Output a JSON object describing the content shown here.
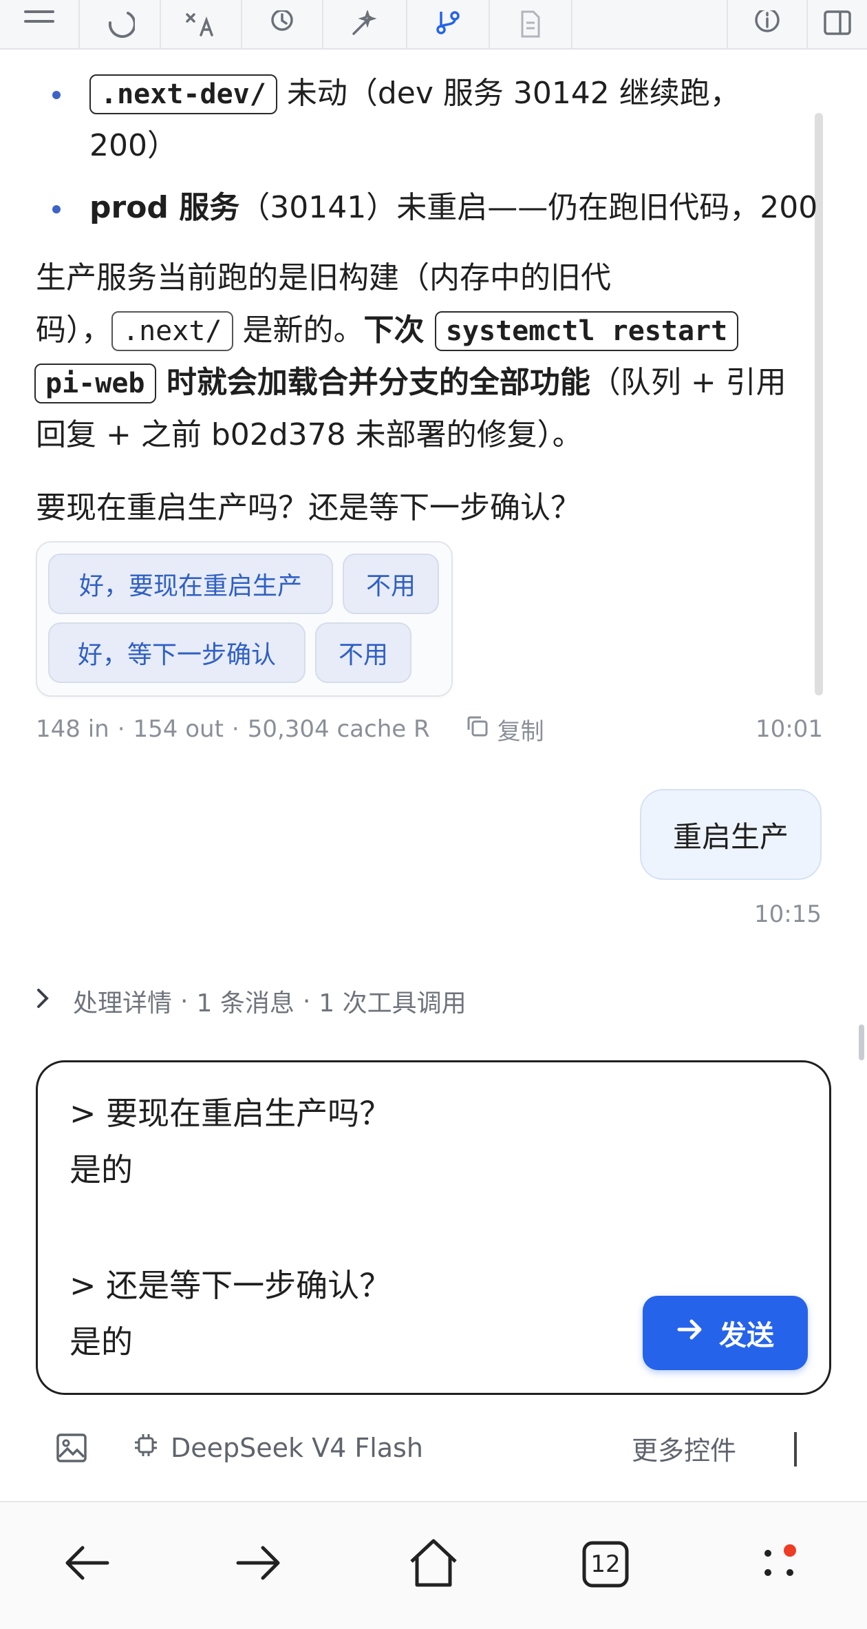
{
  "messages": {
    "bullets": [
      {
        "code": ".next-dev/",
        "text_after": " 未动（dev 服务 30142 继续跑，",
        "line2": "200）"
      },
      {
        "bold": "prod 服务",
        "text_after": "（30141）未重启——仍在跑旧代码，200"
      }
    ],
    "paragraph": {
      "p1_line1": "生产服务当前跑的是旧构建（内存中的旧代",
      "p1_a": "码），",
      "code_next": ".next/",
      "p1_b": " 是新的。",
      "bold_next": "下次 ",
      "code_cmd_1": "systemctl restart",
      "code_cmd_2": "pi-web",
      "bold_load": " 时就会加载合并分支的全部功能",
      "p1_c": "（队列 + 引用",
      "p1_line4": "回复 + 之前 b02d378 未部署的修复）。"
    },
    "question": "要现在重启生产吗？还是等下一步确认？",
    "quick_replies": {
      "r1_yes": "好，要现在重启生产",
      "r1_no": "不用",
      "r2_yes": "好，等下一步确认",
      "r2_no": "不用"
    },
    "meta": {
      "tokens_in": "148 in",
      "tokens_out": "154 out",
      "cache": "50,304 cache R",
      "sep": "·",
      "copy_label": "复制",
      "time": "10:01"
    },
    "user_message": "重启生产",
    "user_time": "10:15",
    "details": {
      "label": "处理详情",
      "messages_count": "1 条消息",
      "tool_calls": "1 次工具调用",
      "sep": "·"
    }
  },
  "composer": {
    "line1": "> 要现在重启生产吗？",
    "line2": "是的",
    "line3": "> 还是等下一步确认？",
    "line4": "是的",
    "send_label": "发送"
  },
  "bottom_bar": {
    "model": "DeepSeek V4 Flash",
    "more_controls": "更多控件"
  },
  "browser_nav": {
    "tab_count": "12"
  },
  "colors": {
    "accent": "#2563eb",
    "chip_blue_text": "#2f5fc4",
    "bullet_dot": "#3c64c8",
    "notification_dot": "#ef3b24"
  },
  "icons": {
    "toolbar": [
      "menu-icon",
      "moon-icon",
      "translate-icon",
      "history-icon",
      "magic-wand-icon",
      "git-branch-icon",
      "document-icon",
      "info-icon",
      "sidebar-panel-icon"
    ]
  }
}
